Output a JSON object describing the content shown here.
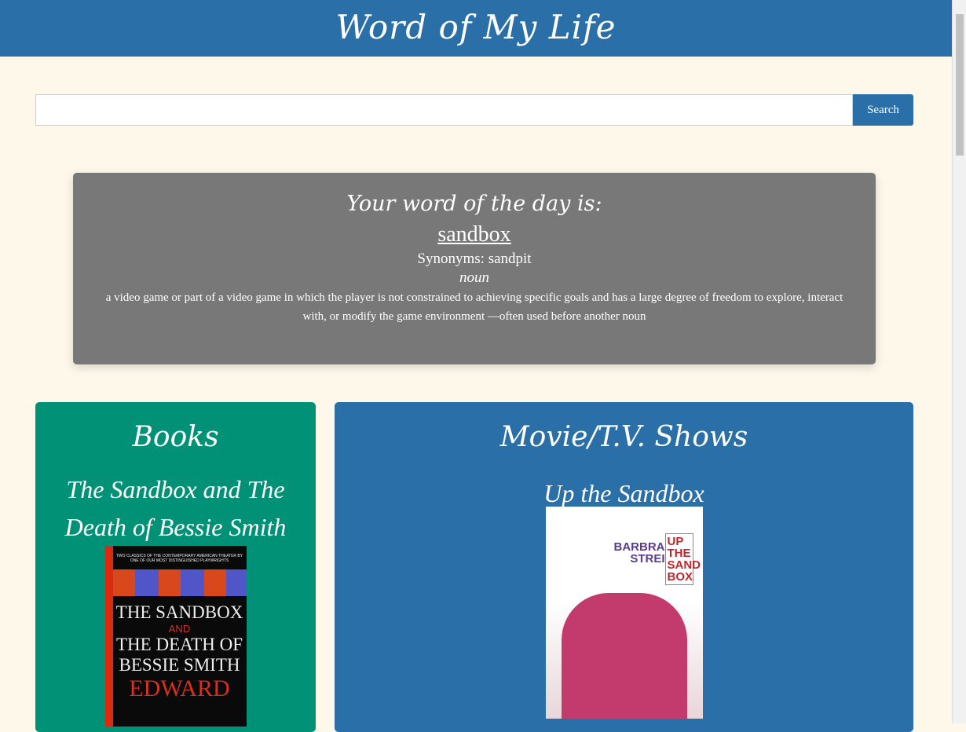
{
  "header": {
    "title": "Word of My Life"
  },
  "search": {
    "value": "",
    "placeholder": "",
    "button": "Search"
  },
  "word_of_day": {
    "heading": "Your word of the day is:",
    "word": "sandbox",
    "synonyms": "Synonyms: sandpit",
    "part_of_speech": "noun",
    "definition": "a video game or part of a video game in which the player is not constrained to achieving specific goals and has a large degree of freedom to explore, interact with, or modify the game environment —often used before another noun"
  },
  "books": {
    "heading": "Books",
    "title": "The Sandbox and The Death of Bessie Smith",
    "cover": {
      "top": "TWO CLASSICS OF THE CONTEMPORARY AMERICAN THEATER BY ONE OF OUR MOST DISTINGUISHED PLAYWRIGHTS",
      "line1": "THE SANDBOX",
      "and": "AND",
      "line2": "THE DEATH OF",
      "line3": "BESSIE SMITH",
      "author": "EDWARD"
    }
  },
  "movies": {
    "heading": "Movie/T.V. Shows",
    "title": "Up the Sandbox",
    "cover": {
      "star": "BARBRA STREI",
      "box": "UP THE SAND BOX"
    }
  }
}
